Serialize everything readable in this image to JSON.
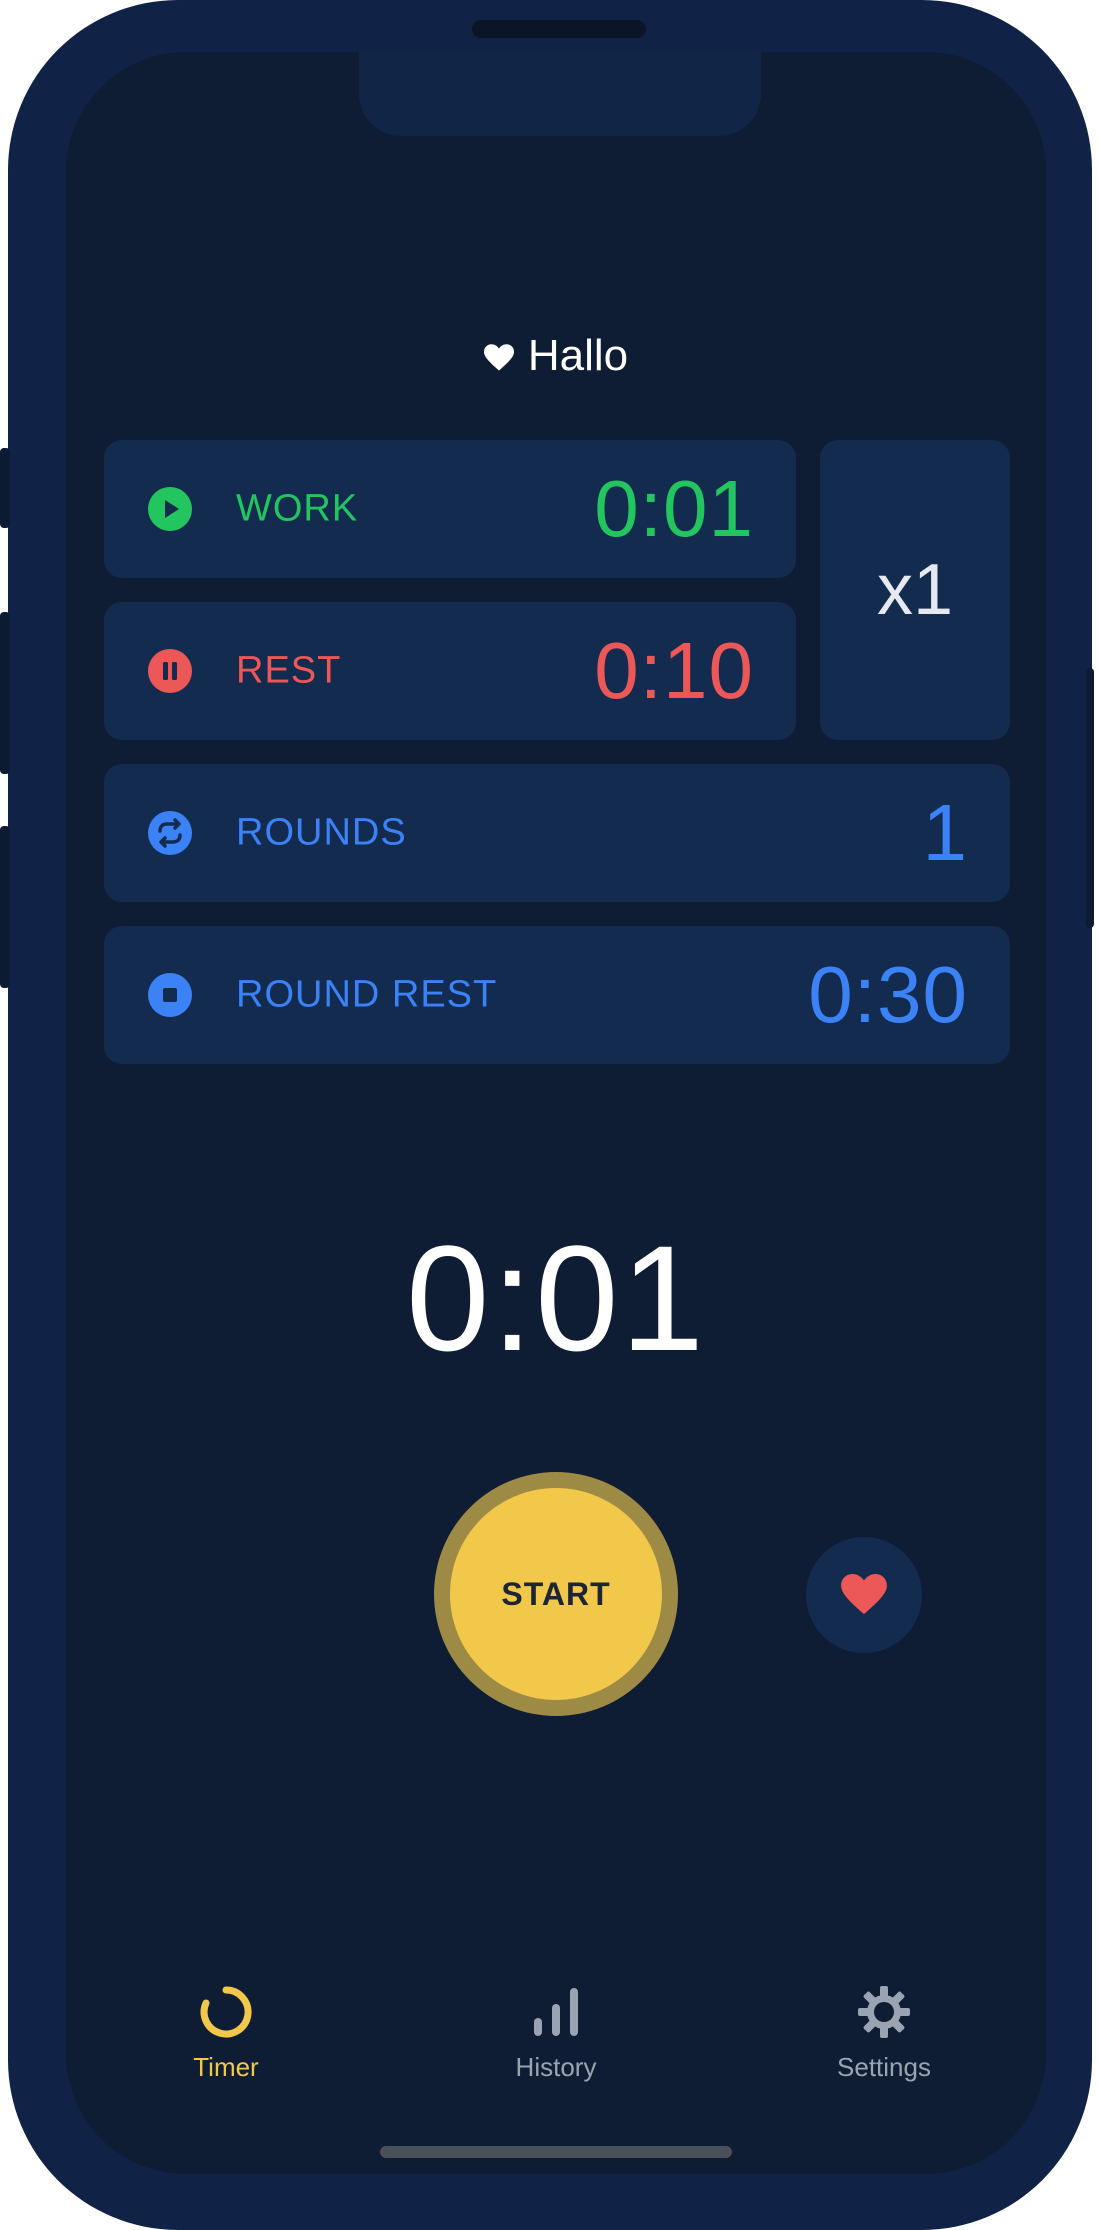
{
  "greeting": {
    "text": "Hallo",
    "icon": "heart-icon"
  },
  "intervals": {
    "work": {
      "label": "WORK",
      "value": "0:01",
      "icon": "play-icon",
      "color": "#22c55e"
    },
    "rest": {
      "label": "REST",
      "value": "0:10",
      "icon": "pause-icon",
      "color": "#ec5757"
    },
    "rounds": {
      "label": "ROUNDS",
      "value": "1",
      "icon": "repeat-icon",
      "color": "#3b82f6"
    },
    "round_rest": {
      "label": "ROUND REST",
      "value": "0:30",
      "icon": "stop-icon",
      "color": "#3b82f6"
    }
  },
  "multiplier": "x1",
  "timer": {
    "display": "0:01"
  },
  "start_button": {
    "label": "START",
    "color": "#f2c84b"
  },
  "favorite_button": {
    "icon": "heart-icon",
    "color": "#ec5757"
  },
  "tabbar": {
    "tabs": [
      {
        "label": "Timer",
        "icon": "timer-icon",
        "active": true,
        "color": "#f2c84b"
      },
      {
        "label": "History",
        "icon": "bar-chart-icon",
        "active": false,
        "color": "#9aa3b2"
      },
      {
        "label": "Settings",
        "icon": "gear-icon",
        "active": false,
        "color": "#9aa3b2"
      }
    ]
  },
  "colors": {
    "background": "#0e1d33",
    "card": "#142b50",
    "frame": "#102346"
  }
}
